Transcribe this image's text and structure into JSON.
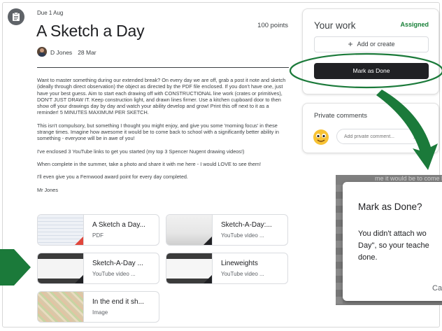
{
  "assignment": {
    "due": "Due 1 Aug",
    "title": "A Sketch a Day",
    "points": "100 points",
    "author": "D Jones",
    "date": "28 Mar",
    "paragraphs": [
      "Want to master something during our extended break? On every day we are off, grab a post it note and sketch (ideally through direct observation) the object as directed by the PDF file enclosed. If you don't have one, just have your best guess. Aim to start each drawing off with CONSTRUCTIONAL line work (crates or primitives), DON'T JUST DRAW IT. Keep construction light, and drawn lines firmer. Use a kitchen cupboard door to then show off your drawings day by day and watch your ability develop and grow! Print this off next to it as a reminder! 5 MINUTES MAXIMUM PER SKETCH.",
      "This isn't compulsory, but something I thought you might enjoy, and give you some 'morning focus' in these strange times. Imagine how awesome it would be to come back to school with a significantly better ability in something - everyone will be in awe of you!",
      "I've enclosed 3 YouTube links to get you started (my top 3 Spencer Nugent drawing videos!)",
      "When complete in the summer, take a photo and share it with me here - I would LOVE to see them!",
      "I'll even give you a Fernwood award point for every day completed.",
      "Mr Jones"
    ]
  },
  "attachments": [
    {
      "name": "A Sketch a Day...",
      "kind": "PDF"
    },
    {
      "name": "Sketch-A-Day:...",
      "kind": "YouTube video  ..."
    },
    {
      "name": "Sketch-A-Day ...",
      "kind": "YouTube video  ..."
    },
    {
      "name": "Lineweights",
      "kind": "YouTube video  ..."
    },
    {
      "name": "In the end it sh...",
      "kind": "Image"
    }
  ],
  "your_work": {
    "title": "Your work",
    "status": "Assigned",
    "add_label": "Add or create",
    "done_label": "Mark as Done"
  },
  "private_comments": {
    "title": "Private comments",
    "placeholder": "Add private comment..."
  },
  "dialog": {
    "bg_text": "me it would be to come back",
    "title": "Mark as Done?",
    "message": "You didn't attach wo\nDay\", so your teache\ndone.",
    "cancel": "Ca"
  },
  "colors": {
    "status_green": "#188038",
    "annotation_green": "#1b7a3a",
    "primary_dark": "#202124"
  }
}
